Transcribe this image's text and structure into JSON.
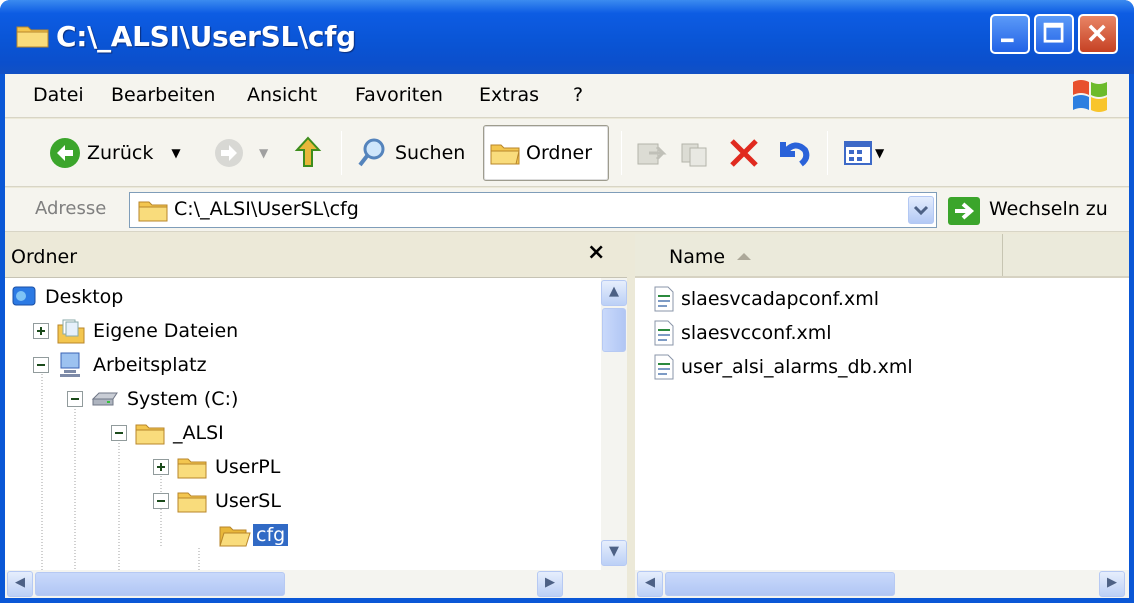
{
  "window": {
    "title": "C:\\_ALSI\\UserSL\\cfg"
  },
  "menu": {
    "items": [
      "Datei",
      "Bearbeiten",
      "Ansicht",
      "Favoriten",
      "Extras",
      "?"
    ]
  },
  "toolbar": {
    "back_label": "Zurück",
    "search_label": "Suchen",
    "folders_label": "Ordner"
  },
  "address": {
    "label": "Adresse",
    "value": "C:\\_ALSI\\UserSL\\cfg",
    "go_label": "Wechseln zu"
  },
  "folders_pane": {
    "title": "Ordner",
    "close_glyph": "×",
    "tree": [
      {
        "label": "Desktop",
        "icon": "desktop-icon"
      },
      {
        "label": "Eigene Dateien",
        "icon": "my-documents-icon"
      },
      {
        "label": "Arbeitsplatz",
        "icon": "my-computer-icon"
      },
      {
        "label": "System (C:)",
        "icon": "drive-icon"
      },
      {
        "label": "_ALSI",
        "icon": "folder-icon"
      },
      {
        "label": "UserPL",
        "icon": "folder-icon"
      },
      {
        "label": "UserSL",
        "icon": "folder-icon"
      },
      {
        "label": "cfg",
        "icon": "folder-open-icon",
        "selected": true
      }
    ]
  },
  "file_list": {
    "column_name": "Name",
    "files": [
      "slaesvcadapconf.xml",
      "slaesvcconf.xml",
      "user_alsi_alarms_db.xml"
    ]
  },
  "colors": {
    "titlebar": "#0a55d6",
    "selection": "#316ac5",
    "chrome": "#ece9d8"
  }
}
